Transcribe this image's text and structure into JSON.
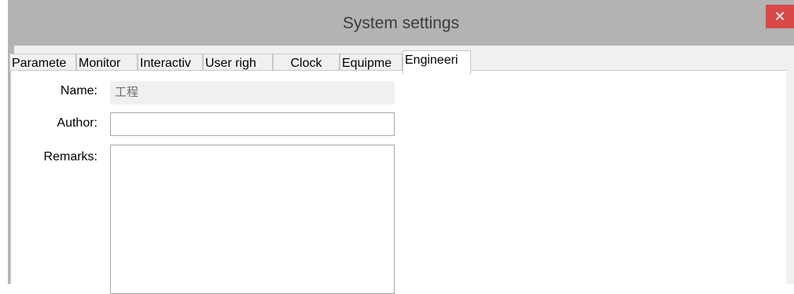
{
  "window": {
    "title": "System settings",
    "close_glyph": "✕"
  },
  "tabs": [
    {
      "label": "Paramete",
      "active": false
    },
    {
      "label": "Monitor",
      "active": false
    },
    {
      "label": "Interactiv",
      "active": false
    },
    {
      "label": "User righ",
      "active": false
    },
    {
      "label": "Clock",
      "active": false
    },
    {
      "label": "Equipme",
      "active": false
    },
    {
      "label": "Engineeri",
      "active": true
    }
  ],
  "form": {
    "name_label": "Name:",
    "name_value": "工程",
    "author_label": "Author:",
    "author_value": "",
    "remarks_label": "Remarks:",
    "remarks_value": ""
  },
  "colors": {
    "close_button": "#d9494a",
    "title_bar": "#b3b3b3"
  }
}
